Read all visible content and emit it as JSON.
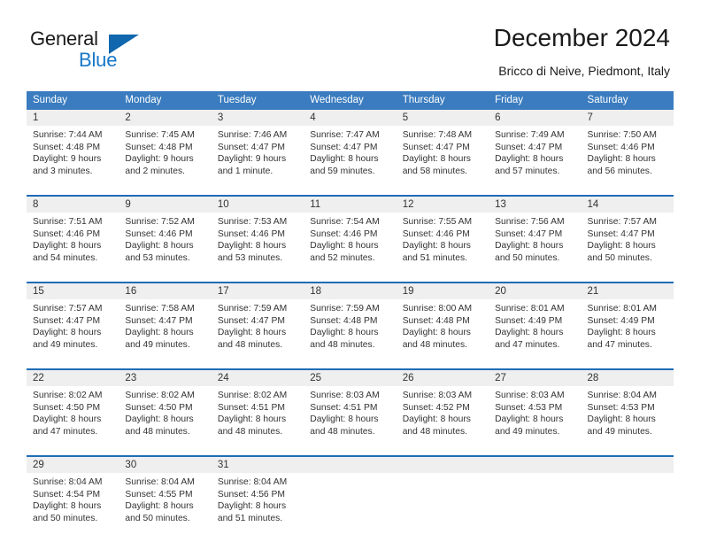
{
  "brand": {
    "name_part1": "General",
    "name_part2": "Blue",
    "accent_color": "#1878c8",
    "triangle_color": "#1067ad"
  },
  "header": {
    "title": "December 2024",
    "subtitle": "Bricco di Neive, Piedmont, Italy"
  },
  "calendar": {
    "header_bg": "#3a7cbf",
    "week_divider_color": "#1f6db5",
    "daynum_band_color": "#efefef",
    "weekdays": [
      "Sunday",
      "Monday",
      "Tuesday",
      "Wednesday",
      "Thursday",
      "Friday",
      "Saturday"
    ],
    "weeks": [
      [
        {
          "day": "1",
          "sunrise": "Sunrise: 7:44 AM",
          "sunset": "Sunset: 4:48 PM",
          "daylight_line1": "Daylight: 9 hours",
          "daylight_line2": "and 3 minutes."
        },
        {
          "day": "2",
          "sunrise": "Sunrise: 7:45 AM",
          "sunset": "Sunset: 4:48 PM",
          "daylight_line1": "Daylight: 9 hours",
          "daylight_line2": "and 2 minutes."
        },
        {
          "day": "3",
          "sunrise": "Sunrise: 7:46 AM",
          "sunset": "Sunset: 4:47 PM",
          "daylight_line1": "Daylight: 9 hours",
          "daylight_line2": "and 1 minute."
        },
        {
          "day": "4",
          "sunrise": "Sunrise: 7:47 AM",
          "sunset": "Sunset: 4:47 PM",
          "daylight_line1": "Daylight: 8 hours",
          "daylight_line2": "and 59 minutes."
        },
        {
          "day": "5",
          "sunrise": "Sunrise: 7:48 AM",
          "sunset": "Sunset: 4:47 PM",
          "daylight_line1": "Daylight: 8 hours",
          "daylight_line2": "and 58 minutes."
        },
        {
          "day": "6",
          "sunrise": "Sunrise: 7:49 AM",
          "sunset": "Sunset: 4:47 PM",
          "daylight_line1": "Daylight: 8 hours",
          "daylight_line2": "and 57 minutes."
        },
        {
          "day": "7",
          "sunrise": "Sunrise: 7:50 AM",
          "sunset": "Sunset: 4:46 PM",
          "daylight_line1": "Daylight: 8 hours",
          "daylight_line2": "and 56 minutes."
        }
      ],
      [
        {
          "day": "8",
          "sunrise": "Sunrise: 7:51 AM",
          "sunset": "Sunset: 4:46 PM",
          "daylight_line1": "Daylight: 8 hours",
          "daylight_line2": "and 54 minutes."
        },
        {
          "day": "9",
          "sunrise": "Sunrise: 7:52 AM",
          "sunset": "Sunset: 4:46 PM",
          "daylight_line1": "Daylight: 8 hours",
          "daylight_line2": "and 53 minutes."
        },
        {
          "day": "10",
          "sunrise": "Sunrise: 7:53 AM",
          "sunset": "Sunset: 4:46 PM",
          "daylight_line1": "Daylight: 8 hours",
          "daylight_line2": "and 53 minutes."
        },
        {
          "day": "11",
          "sunrise": "Sunrise: 7:54 AM",
          "sunset": "Sunset: 4:46 PM",
          "daylight_line1": "Daylight: 8 hours",
          "daylight_line2": "and 52 minutes."
        },
        {
          "day": "12",
          "sunrise": "Sunrise: 7:55 AM",
          "sunset": "Sunset: 4:46 PM",
          "daylight_line1": "Daylight: 8 hours",
          "daylight_line2": "and 51 minutes."
        },
        {
          "day": "13",
          "sunrise": "Sunrise: 7:56 AM",
          "sunset": "Sunset: 4:47 PM",
          "daylight_line1": "Daylight: 8 hours",
          "daylight_line2": "and 50 minutes."
        },
        {
          "day": "14",
          "sunrise": "Sunrise: 7:57 AM",
          "sunset": "Sunset: 4:47 PM",
          "daylight_line1": "Daylight: 8 hours",
          "daylight_line2": "and 50 minutes."
        }
      ],
      [
        {
          "day": "15",
          "sunrise": "Sunrise: 7:57 AM",
          "sunset": "Sunset: 4:47 PM",
          "daylight_line1": "Daylight: 8 hours",
          "daylight_line2": "and 49 minutes."
        },
        {
          "day": "16",
          "sunrise": "Sunrise: 7:58 AM",
          "sunset": "Sunset: 4:47 PM",
          "daylight_line1": "Daylight: 8 hours",
          "daylight_line2": "and 49 minutes."
        },
        {
          "day": "17",
          "sunrise": "Sunrise: 7:59 AM",
          "sunset": "Sunset: 4:47 PM",
          "daylight_line1": "Daylight: 8 hours",
          "daylight_line2": "and 48 minutes."
        },
        {
          "day": "18",
          "sunrise": "Sunrise: 7:59 AM",
          "sunset": "Sunset: 4:48 PM",
          "daylight_line1": "Daylight: 8 hours",
          "daylight_line2": "and 48 minutes."
        },
        {
          "day": "19",
          "sunrise": "Sunrise: 8:00 AM",
          "sunset": "Sunset: 4:48 PM",
          "daylight_line1": "Daylight: 8 hours",
          "daylight_line2": "and 48 minutes."
        },
        {
          "day": "20",
          "sunrise": "Sunrise: 8:01 AM",
          "sunset": "Sunset: 4:49 PM",
          "daylight_line1": "Daylight: 8 hours",
          "daylight_line2": "and 47 minutes."
        },
        {
          "day": "21",
          "sunrise": "Sunrise: 8:01 AM",
          "sunset": "Sunset: 4:49 PM",
          "daylight_line1": "Daylight: 8 hours",
          "daylight_line2": "and 47 minutes."
        }
      ],
      [
        {
          "day": "22",
          "sunrise": "Sunrise: 8:02 AM",
          "sunset": "Sunset: 4:50 PM",
          "daylight_line1": "Daylight: 8 hours",
          "daylight_line2": "and 47 minutes."
        },
        {
          "day": "23",
          "sunrise": "Sunrise: 8:02 AM",
          "sunset": "Sunset: 4:50 PM",
          "daylight_line1": "Daylight: 8 hours",
          "daylight_line2": "and 48 minutes."
        },
        {
          "day": "24",
          "sunrise": "Sunrise: 8:02 AM",
          "sunset": "Sunset: 4:51 PM",
          "daylight_line1": "Daylight: 8 hours",
          "daylight_line2": "and 48 minutes."
        },
        {
          "day": "25",
          "sunrise": "Sunrise: 8:03 AM",
          "sunset": "Sunset: 4:51 PM",
          "daylight_line1": "Daylight: 8 hours",
          "daylight_line2": "and 48 minutes."
        },
        {
          "day": "26",
          "sunrise": "Sunrise: 8:03 AM",
          "sunset": "Sunset: 4:52 PM",
          "daylight_line1": "Daylight: 8 hours",
          "daylight_line2": "and 48 minutes."
        },
        {
          "day": "27",
          "sunrise": "Sunrise: 8:03 AM",
          "sunset": "Sunset: 4:53 PM",
          "daylight_line1": "Daylight: 8 hours",
          "daylight_line2": "and 49 minutes."
        },
        {
          "day": "28",
          "sunrise": "Sunrise: 8:04 AM",
          "sunset": "Sunset: 4:53 PM",
          "daylight_line1": "Daylight: 8 hours",
          "daylight_line2": "and 49 minutes."
        }
      ],
      [
        {
          "day": "29",
          "sunrise": "Sunrise: 8:04 AM",
          "sunset": "Sunset: 4:54 PM",
          "daylight_line1": "Daylight: 8 hours",
          "daylight_line2": "and 50 minutes."
        },
        {
          "day": "30",
          "sunrise": "Sunrise: 8:04 AM",
          "sunset": "Sunset: 4:55 PM",
          "daylight_line1": "Daylight: 8 hours",
          "daylight_line2": "and 50 minutes."
        },
        {
          "day": "31",
          "sunrise": "Sunrise: 8:04 AM",
          "sunset": "Sunset: 4:56 PM",
          "daylight_line1": "Daylight: 8 hours",
          "daylight_line2": "and 51 minutes."
        },
        {
          "day": "",
          "sunrise": "",
          "sunset": "",
          "daylight_line1": "",
          "daylight_line2": ""
        },
        {
          "day": "",
          "sunrise": "",
          "sunset": "",
          "daylight_line1": "",
          "daylight_line2": ""
        },
        {
          "day": "",
          "sunrise": "",
          "sunset": "",
          "daylight_line1": "",
          "daylight_line2": ""
        },
        {
          "day": "",
          "sunrise": "",
          "sunset": "",
          "daylight_line1": "",
          "daylight_line2": ""
        }
      ]
    ]
  }
}
